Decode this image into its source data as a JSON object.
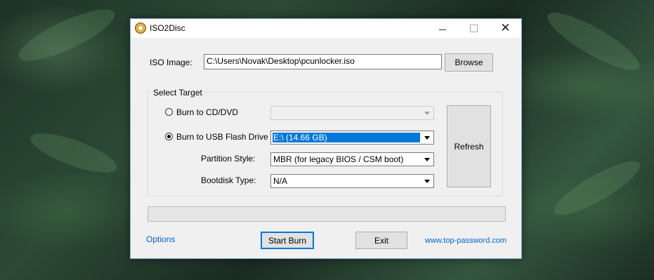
{
  "window": {
    "title": "ISO2Disc"
  },
  "iso": {
    "label": "ISO Image:",
    "path": "C:\\Users\\Novak\\Desktop\\pcunlocker.iso",
    "browse_label": "Browse"
  },
  "target": {
    "group_label": "Select Target",
    "cd": {
      "label": "Burn to CD/DVD",
      "selected": false,
      "drive_value": ""
    },
    "usb": {
      "label": "Burn to USB Flash Drive",
      "selected": true,
      "drive_value": "E:\\ (14.66 GB)"
    },
    "partition": {
      "label": "Partition Style:",
      "value": "MBR (for legacy BIOS / CSM boot)"
    },
    "bootdisk": {
      "label": "Bootdisk Type:",
      "value": "N/A"
    },
    "refresh_label": "Refresh"
  },
  "progress": {
    "value": 0
  },
  "footer": {
    "options_label": "Options",
    "start_label": "Start Burn",
    "exit_label": "Exit",
    "website": "www.top-password.com"
  }
}
